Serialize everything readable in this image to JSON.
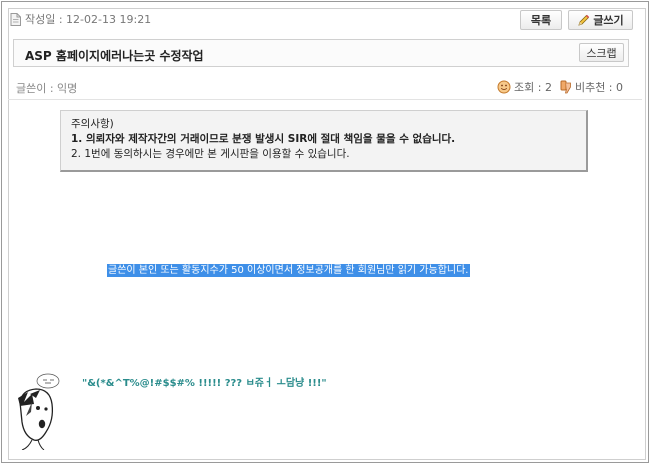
{
  "meta": {
    "date_label": "작성일 : 12-02-13 19:21"
  },
  "toolbar": {
    "list_label": "목록",
    "write_label": "글쓰기"
  },
  "post": {
    "title": "ASP 홈페이지에러나는곳 수정작업",
    "scrap_label": "스크랩"
  },
  "author": {
    "label": "글쓴이 : 익명"
  },
  "stats": {
    "views": "조회 : 2",
    "dislikes": "비추천 : 0"
  },
  "notice": {
    "heading": "주의사항)",
    "line1": "1. 의뢰자와 제작자간의 거래이므로 분쟁 발생시 SIR에 절대 책임을 물을 수 없습니다.",
    "line2": "2. 1번에 동의하시는 경우에만 본 게시판을 이용할 수 있습니다."
  },
  "body": {
    "restricted_text": "글쓴이 본인 또는 활동지수가 50 이상이면서 정보공개를 한 회원님만 읽기 가능합니다."
  },
  "signature": {
    "text": "\"&(*&^T%@!#$$#% !!!!! ??? ㅂ쥬ㅓ ㅗ담냥 !!!\""
  }
}
